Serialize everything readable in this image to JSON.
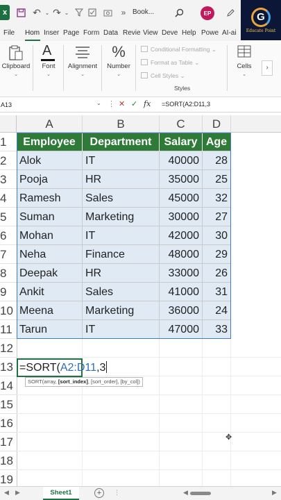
{
  "titlebar": {
    "app_icon": "excel-save-icon",
    "doc_title": "Book...",
    "user_initials": "EP",
    "logo_letter": "G",
    "logo_text": "Educate Point"
  },
  "tabs": [
    "File",
    "Hom",
    "Inser",
    "Page",
    "Form",
    "Data",
    "Revie",
    "View",
    "Deve",
    "Help",
    "Powe",
    "AI-ai"
  ],
  "ribbon": {
    "clipboard": "Clipboard",
    "font": "Font",
    "alignment": "Alignment",
    "number": "Number",
    "number_symbol": "%",
    "conditional_formatting": "Conditional Formatting",
    "format_as_table": "Format as Table",
    "cell_styles": "Cell Styles",
    "styles_group": "Styles",
    "cells": "Cells"
  },
  "formula_bar": {
    "name_box": "A13",
    "fx": "fx",
    "formula": "=SORT(A2:D11,3"
  },
  "sheet": {
    "columns": [
      "A",
      "B",
      "C",
      "D"
    ],
    "row_numbers": [
      "1",
      "2",
      "3",
      "4",
      "5",
      "6",
      "7",
      "8",
      "9",
      "10",
      "11",
      "12",
      "13",
      "14",
      "15",
      "16",
      "17",
      "18",
      "19"
    ],
    "header": [
      "Employee",
      "Department",
      "Salary",
      "Age"
    ],
    "rows": [
      [
        "Alok",
        "IT",
        "40000",
        "28"
      ],
      [
        "Pooja",
        "HR",
        "35000",
        "25"
      ],
      [
        "Ramesh",
        "Sales",
        "45000",
        "32"
      ],
      [
        "Suman",
        "Marketing",
        "30000",
        "27"
      ],
      [
        "Mohan",
        "IT",
        "42000",
        "30"
      ],
      [
        "Neha",
        "Finance",
        "48000",
        "29"
      ],
      [
        "Deepak",
        "HR",
        "33000",
        "26"
      ],
      [
        "Ankit",
        "Sales",
        "41000",
        "31"
      ],
      [
        "Meena",
        "Marketing",
        "36000",
        "24"
      ],
      [
        "Tarun",
        "IT",
        "47000",
        "33"
      ]
    ],
    "active_cell_prefix": "=SORT(",
    "active_cell_ref": "A2:D11",
    "active_cell_suffix": ",3",
    "tooltip_prefix": "SORT(array, ",
    "tooltip_bold": "[sort_index]",
    "tooltip_suffix": ", [sort_order], [by_col])",
    "header_color": "#2e7a37",
    "row_fill_color": "#dfeaf5"
  },
  "sheet_tabs": {
    "active": "Sheet1",
    "add_label": "+"
  }
}
